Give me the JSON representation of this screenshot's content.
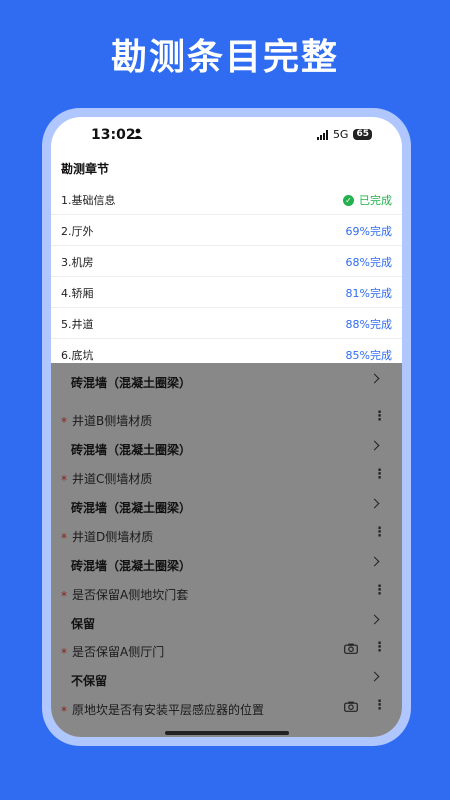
{
  "headline": "勘测条目完整",
  "status_bar": {
    "time": "13:02",
    "network": "5G",
    "battery": "65"
  },
  "sheet": {
    "title": "勘测章节",
    "chapters": [
      {
        "label": "1.基础信息",
        "status": "已完成",
        "done": true
      },
      {
        "label": "2.厅外",
        "status": "69%完成",
        "done": false
      },
      {
        "label": "3.机房",
        "status": "68%完成",
        "done": false
      },
      {
        "label": "4.轿厢",
        "status": "81%完成",
        "done": false
      },
      {
        "label": "5.井道",
        "status": "88%完成",
        "done": false
      },
      {
        "label": "6.底坑",
        "status": "85%完成",
        "done": false
      }
    ]
  },
  "form": {
    "items": [
      {
        "question": "",
        "answer": "砖混墙（混凝土圈梁）",
        "required": false,
        "camera": false
      },
      {
        "question": "井道B侧墙材质",
        "answer": "砖混墙（混凝土圈梁）",
        "required": true,
        "camera": false
      },
      {
        "question": "井道C侧墙材质",
        "answer": "砖混墙（混凝土圈梁）",
        "required": true,
        "camera": false
      },
      {
        "question": "井道D侧墙材质",
        "answer": "砖混墙（混凝土圈梁）",
        "required": true,
        "camera": false
      },
      {
        "question": "是否保留A侧地坎门套",
        "answer": "保留",
        "required": true,
        "camera": false
      },
      {
        "question": "是否保留A侧厅门",
        "answer": "不保留",
        "required": true,
        "camera": true
      },
      {
        "question": "原地坎是否有安装平层感应器的位置",
        "answer": "",
        "required": true,
        "camera": true
      }
    ]
  }
}
